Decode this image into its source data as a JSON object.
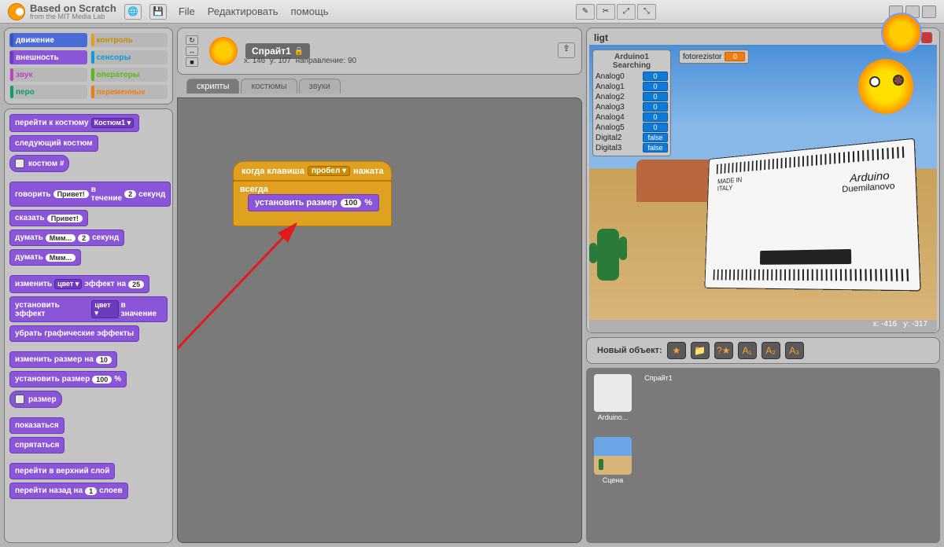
{
  "brand": {
    "title": "Based on Scratch",
    "subtitle": "from the MIT Media Lab"
  },
  "menu": {
    "file": "File",
    "edit": "Редактировать",
    "help": "помощь"
  },
  "categories": {
    "motion": "движение",
    "control": "контроль",
    "looks": "внешность",
    "sensing": "сенсоры",
    "sound": "звук",
    "operators": "операторы",
    "pen": "перо",
    "variables": "переменные"
  },
  "palette_blocks": {
    "b1": "перейти к костюму",
    "b1_dd": "Костюм1 ▾",
    "b2": "следующий костюм",
    "b3": "костюм #",
    "b4_a": "говорить",
    "b4_b": "Привет!",
    "b4_c": "в течение",
    "b4_d": "2",
    "b4_e": "секунд",
    "b5_a": "сказать",
    "b5_b": "Привет!",
    "b6_a": "думать",
    "b6_b": "Ммм...",
    "b6_c": "2",
    "b6_d": "секунд",
    "b7_a": "думать",
    "b7_b": "Ммм...",
    "b8_a": "изменить",
    "b8_b": "цвет ▾",
    "b8_c": "эффект на",
    "b8_d": "25",
    "b9_a": "установить эффект",
    "b9_b": "цвет ▾",
    "b9_c": "в значение",
    "b10": "убрать графические эффекты",
    "b11_a": "изменить размер на",
    "b11_b": "10",
    "b12_a": "установить размер",
    "b12_b": "100",
    "b12_c": "%",
    "b13": "размер",
    "b14": "показаться",
    "b15": "спрятаться",
    "b16": "перейти в верхний слой",
    "b17_a": "перейти назад на",
    "b17_b": "1",
    "b17_c": "слоев"
  },
  "sprite": {
    "name": "Спрайт1",
    "coords_x_lbl": "x:",
    "coords_x": "146",
    "coords_y_lbl": "y:",
    "coords_y": "107",
    "dir_lbl": "направление:",
    "dir": "90"
  },
  "tabs": {
    "scripts": "скрипты",
    "costumes": "костюмы",
    "sounds": "звуки"
  },
  "script_blocks": {
    "hat_a": "когда клавиша",
    "hat_b": "пробел ▾",
    "hat_c": "нажата",
    "forever": "всегда",
    "inner_a": "установить размер",
    "inner_b": "100",
    "inner_c": "%"
  },
  "stage": {
    "title": "ligt",
    "arduino_label1": "Arduino",
    "arduino_label2": "Duemilanovo",
    "made_in": "MADE IN\nITALY"
  },
  "monitors": {
    "panel_hdr": "Arduino1 Searching",
    "rows": [
      {
        "label": "Analog0",
        "val": "0"
      },
      {
        "label": "Analog1",
        "val": "0"
      },
      {
        "label": "Analog2",
        "val": "0"
      },
      {
        "label": "Analog3",
        "val": "0"
      },
      {
        "label": "Analog4",
        "val": "0"
      },
      {
        "label": "Analog5",
        "val": "0"
      },
      {
        "label": "Digital2",
        "val": "false"
      },
      {
        "label": "Digital3",
        "val": "false"
      }
    ],
    "top_label": "fotorezistor",
    "top_val": "0"
  },
  "mouse": {
    "x_lbl": "x:",
    "x": "-416",
    "y_lbl": "y:",
    "y": "-317"
  },
  "newobj": {
    "label": "Новый объект:"
  },
  "sprites": {
    "s1": "Arduino...",
    "s2": "Спрайт1",
    "stage": "Сцена"
  }
}
